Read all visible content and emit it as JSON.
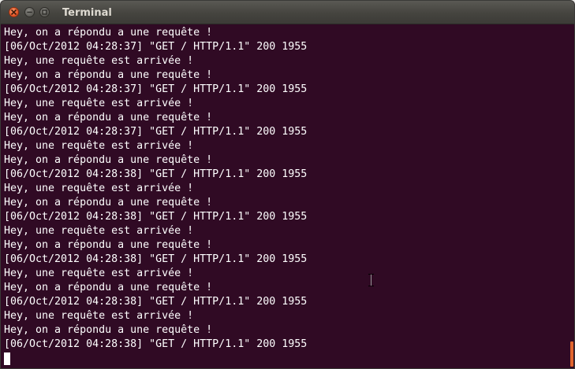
{
  "window": {
    "title": "Terminal",
    "controls": {
      "close_icon": "close-icon",
      "minimize_icon": "minimize-icon",
      "maximize_icon": "maximize-icon"
    }
  },
  "terminal": {
    "background": "#300a24",
    "foreground": "#ffffff",
    "lines": [
      "Hey, on a répondu a une requête !",
      "[06/Oct/2012 04:28:37] \"GET / HTTP/1.1\" 200 1955",
      "Hey, une requête est arrivée !",
      "Hey, on a répondu a une requête !",
      "[06/Oct/2012 04:28:37] \"GET / HTTP/1.1\" 200 1955",
      "Hey, une requête est arrivée !",
      "Hey, on a répondu a une requête !",
      "[06/Oct/2012 04:28:37] \"GET / HTTP/1.1\" 200 1955",
      "Hey, une requête est arrivée !",
      "Hey, on a répondu a une requête !",
      "[06/Oct/2012 04:28:38] \"GET / HTTP/1.1\" 200 1955",
      "Hey, une requête est arrivée !",
      "Hey, on a répondu a une requête !",
      "[06/Oct/2012 04:28:38] \"GET / HTTP/1.1\" 200 1955",
      "Hey, une requête est arrivée !",
      "Hey, on a répondu a une requête !",
      "[06/Oct/2012 04:28:38] \"GET / HTTP/1.1\" 200 1955",
      "Hey, une requête est arrivée !",
      "Hey, on a répondu a une requête !",
      "[06/Oct/2012 04:28:38] \"GET / HTTP/1.1\" 200 1955",
      "Hey, une requête est arrivée !",
      "Hey, on a répondu a une requête !",
      "[06/Oct/2012 04:28:38] \"GET / HTTP/1.1\" 200 1955"
    ],
    "scrollbar_color": "#e0652e",
    "pointer_icon": "text-cursor-icon"
  }
}
